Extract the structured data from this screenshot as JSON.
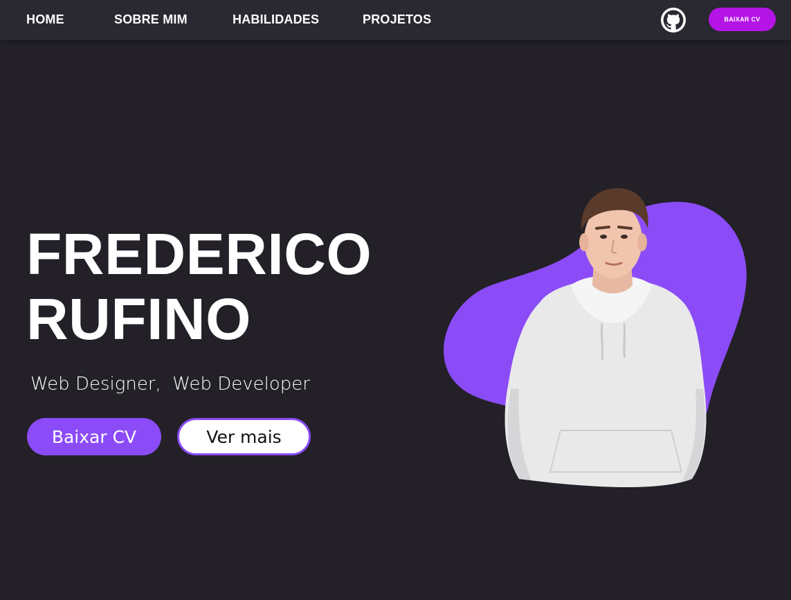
{
  "nav": {
    "links": [
      {
        "label": "HOME"
      },
      {
        "label": "SOBRE MIM"
      },
      {
        "label": "HABILIDADES"
      },
      {
        "label": "PROJETOS"
      }
    ],
    "github_icon": "github-icon",
    "cv_button_label": "BAIXAR CV"
  },
  "hero": {
    "name_line1": "FREDERICO",
    "name_line2": "RUFINO",
    "subtitle": "Web Designer,  Web Developer",
    "primary_button_label": "Baixar CV",
    "secondary_button_label": "Ver mais"
  },
  "colors": {
    "background": "#232028",
    "navbar": "#2a2830",
    "accent": "#8b4cf7",
    "nav_button": "#b414e6",
    "text": "#ffffff"
  }
}
